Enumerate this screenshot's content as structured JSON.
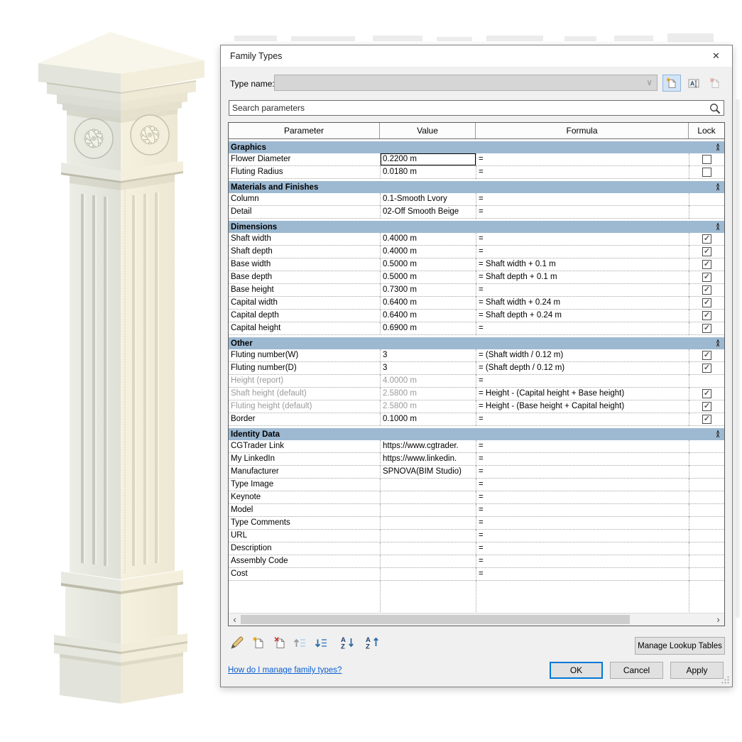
{
  "window": {
    "title": "Family Types",
    "close": "✕"
  },
  "type_name": {
    "label": "Type name:",
    "value": "",
    "buttons": {
      "new_type": "New type",
      "rename": "Rename type",
      "delete_type": "Delete type"
    }
  },
  "search": {
    "placeholder": "Search parameters"
  },
  "table": {
    "headers": {
      "parameter": "Parameter",
      "value": "Value",
      "formula": "Formula",
      "lock": "Lock"
    },
    "sections": [
      {
        "name": "Graphics",
        "rows": [
          {
            "param": "Flower Diameter",
            "value": "0.2200 m",
            "formula": "=",
            "lock": "unchecked",
            "focused": true
          },
          {
            "param": "Fluting Radius",
            "value": "0.0180 m",
            "formula": "=",
            "lock": "unchecked"
          }
        ]
      },
      {
        "name": "Materials and Finishes",
        "rows": [
          {
            "param": "Column",
            "value": "0.1-Smooth Lvory",
            "formula": "=",
            "lock": "none"
          },
          {
            "param": "Detail",
            "value": "02-Off Smooth Beige",
            "formula": "=",
            "lock": "none"
          }
        ]
      },
      {
        "name": "Dimensions",
        "rows": [
          {
            "param": "Shaft width",
            "value": "0.4000 m",
            "formula": "=",
            "lock": "checked"
          },
          {
            "param": "Shaft depth",
            "value": "0.4000 m",
            "formula": "=",
            "lock": "checked"
          },
          {
            "param": "Base width",
            "value": "0.5000 m",
            "formula": "= Shaft width + 0.1 m",
            "lock": "checked"
          },
          {
            "param": "Base depth",
            "value": "0.5000 m",
            "formula": "= Shaft depth + 0.1 m",
            "lock": "checked"
          },
          {
            "param": "Base height",
            "value": "0.7300 m",
            "formula": "=",
            "lock": "checked"
          },
          {
            "param": "Capital width",
            "value": "0.6400 m",
            "formula": "= Shaft width + 0.24 m",
            "lock": "checked"
          },
          {
            "param": "Capital depth",
            "value": "0.6400 m",
            "formula": "= Shaft depth + 0.24 m",
            "lock": "checked"
          },
          {
            "param": "Capital height",
            "value": "0.6900 m",
            "formula": "=",
            "lock": "checked"
          }
        ]
      },
      {
        "name": "Other",
        "rows": [
          {
            "param": "Fluting number(W)",
            "value": "3",
            "formula": "= (Shaft width / 0.12 m)",
            "lock": "checked"
          },
          {
            "param": "Fluting number(D)",
            "value": "3",
            "formula": "= (Shaft depth / 0.12 m)",
            "lock": "checked"
          },
          {
            "param": "Height (report)",
            "value": "4.0000 m",
            "formula": "=",
            "lock": "none",
            "disabled": true
          },
          {
            "param": "Shaft height (default)",
            "value": "2.5800 m",
            "formula": "= Height - (Capital height + Base height)",
            "lock": "checked",
            "disabled": true
          },
          {
            "param": "Fluting height (default)",
            "value": "2.5800 m",
            "formula": "= Height - (Base height + Capital height)",
            "lock": "checked",
            "disabled": true
          },
          {
            "param": "Border",
            "value": "0.1000 m",
            "formula": "=",
            "lock": "checked"
          }
        ]
      },
      {
        "name": "Identity Data",
        "rows": [
          {
            "param": "CGTrader Link",
            "value": "https://www.cgtrader.",
            "formula": "=",
            "lock": "none"
          },
          {
            "param": "My LinkedIn",
            "value": "https://www.linkedin.",
            "formula": "=",
            "lock": "none"
          },
          {
            "param": "Manufacturer",
            "value": "SPNOVA(BIM Studio)",
            "formula": "=",
            "lock": "none"
          },
          {
            "param": "Type Image",
            "value": "",
            "formula": "=",
            "lock": "none"
          },
          {
            "param": "Keynote",
            "value": "",
            "formula": "=",
            "lock": "none"
          },
          {
            "param": "Model",
            "value": "",
            "formula": "=",
            "lock": "none"
          },
          {
            "param": "Type Comments",
            "value": "",
            "formula": "=",
            "lock": "none"
          },
          {
            "param": "URL",
            "value": "",
            "formula": "=",
            "lock": "none"
          },
          {
            "param": "Description",
            "value": "",
            "formula": "=",
            "lock": "none"
          },
          {
            "param": "Assembly Code",
            "value": "",
            "formula": "=",
            "lock": "none"
          },
          {
            "param": "Cost",
            "value": "",
            "formula": "=",
            "lock": "none"
          }
        ]
      }
    ]
  },
  "toolbar": {
    "icon_names": [
      "edit-parameter-icon",
      "new-parameter-icon",
      "delete-parameter-icon",
      "move-up-icon",
      "move-down-icon",
      "sort-ascending-icon",
      "sort-descending-icon"
    ]
  },
  "footer": {
    "manage_lookup": "Manage Lookup Tables",
    "help_link": "How do I manage family types?",
    "ok": "OK",
    "cancel": "Cancel",
    "apply": "Apply"
  },
  "scrollbar": {
    "left": "‹",
    "right": "›"
  },
  "icons": {
    "collapse": "∧",
    "check": "✓",
    "combo_chevron": "∨"
  },
  "colors": {
    "section_header": "#9db9d2",
    "focus_ring": "#0078d7",
    "link": "#0b5fd0",
    "column_face_light": "#f3efdd",
    "column_face_shade": "#e5e6df"
  }
}
